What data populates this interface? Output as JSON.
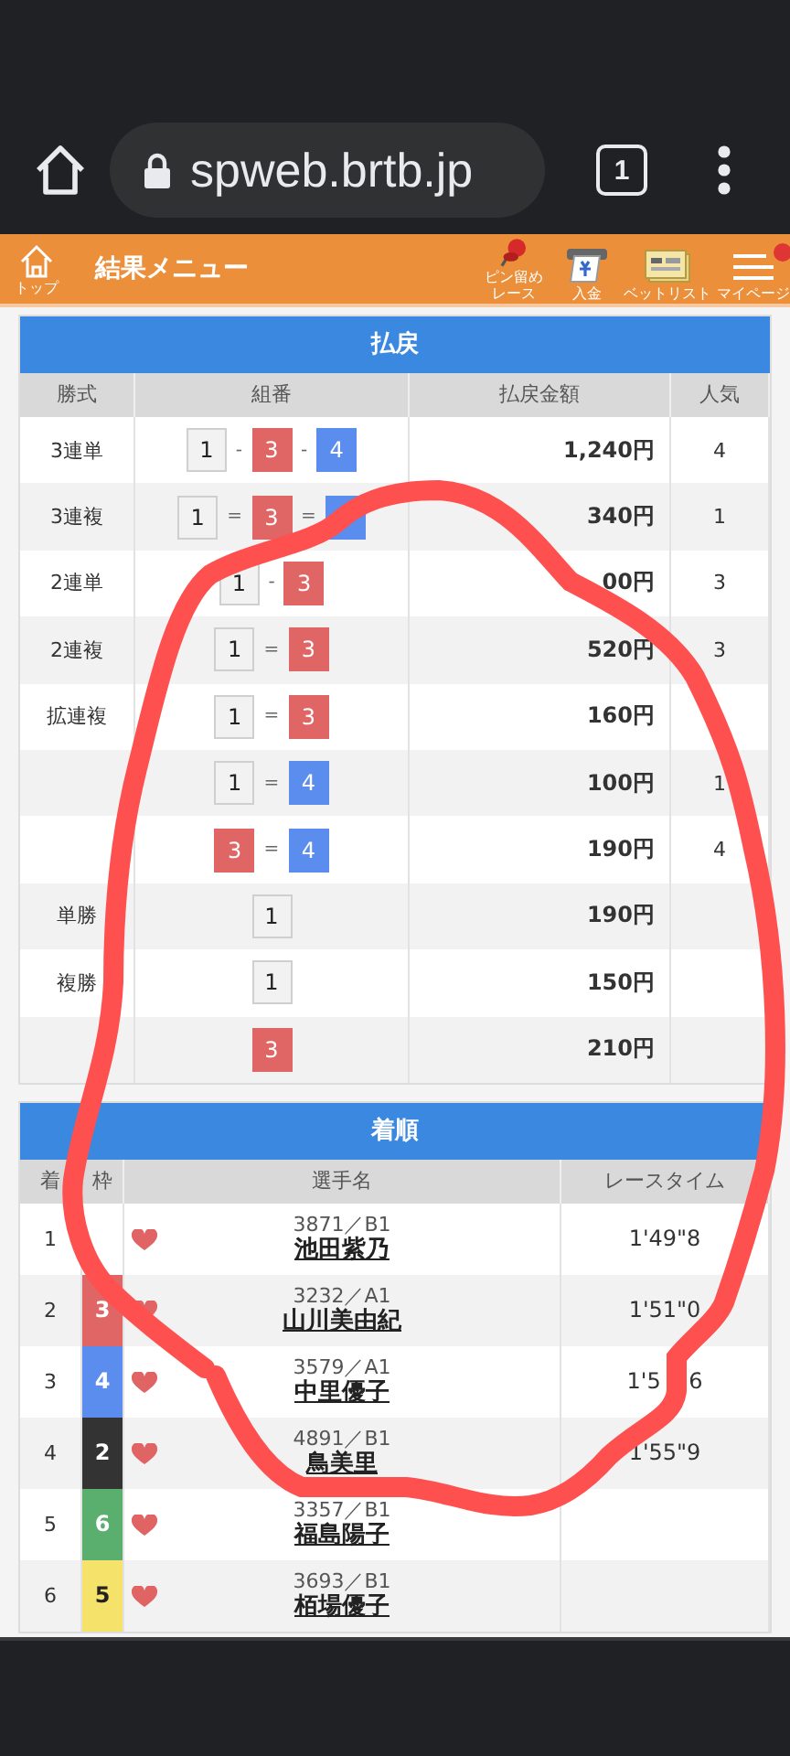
{
  "browser": {
    "url": "spweb.brtb.jp",
    "tab_count": "1"
  },
  "header": {
    "home_label": "トップ",
    "title": "結果メニュー",
    "actions": [
      {
        "kind": "pin",
        "label": "ピン留めレース"
      },
      {
        "kind": "deposit",
        "label": "入金"
      },
      {
        "kind": "betlist",
        "label": "ベットリスト"
      },
      {
        "kind": "mypage",
        "label": "マイページ",
        "badge": true
      }
    ]
  },
  "payout": {
    "title": "払戻",
    "columns": [
      "勝式",
      "組番",
      "払戻金額",
      "人気"
    ],
    "rows": [
      {
        "bet_type": "3連単",
        "combo": {
          "separator": "-",
          "boxes": [
            {
              "number": "1",
              "color": "#f2f2f2"
            },
            {
              "number": "3",
              "color": "#e06666"
            },
            {
              "number": "4",
              "color": "#5b8def"
            }
          ]
        },
        "amount": "1,240円",
        "popularity": "4"
      },
      {
        "bet_type": "3連複",
        "combo": {
          "separator": "=",
          "boxes": [
            {
              "number": "1",
              "color": "#f2f2f2"
            },
            {
              "number": "3",
              "color": "#e06666"
            },
            {
              "color": "#5b8def"
            }
          ]
        },
        "amount": "340円",
        "popularity": "1"
      },
      {
        "bet_type": "2連単",
        "combo": {
          "separator": "-",
          "boxes": [
            {
              "number": "1",
              "color": "#f2f2f2"
            },
            {
              "number": "3",
              "color": "#e06666"
            }
          ]
        },
        "amount": "00円",
        "popularity": "3"
      },
      {
        "bet_type": "2連複",
        "combo": {
          "separator": "=",
          "boxes": [
            {
              "number": "1",
              "color": "#f2f2f2"
            },
            {
              "number": "3",
              "color": "#e06666"
            }
          ]
        },
        "amount": "520円",
        "popularity": "3"
      },
      {
        "bet_type": "拡連複",
        "combo": {
          "separator": "=",
          "boxes": [
            {
              "number": "1",
              "color": "#f2f2f2"
            },
            {
              "number": "3",
              "color": "#e06666"
            }
          ]
        },
        "amount": "160円"
      },
      {
        "combo": {
          "separator": "=",
          "boxes": [
            {
              "number": "1",
              "color": "#f2f2f2"
            },
            {
              "number": "4",
              "color": "#5b8def"
            }
          ]
        },
        "amount": "100円",
        "popularity": "1"
      },
      {
        "combo": {
          "separator": "=",
          "boxes": [
            {
              "number": "3",
              "color": "#e06666"
            },
            {
              "number": "4",
              "color": "#5b8def"
            }
          ]
        },
        "amount": "190円",
        "popularity": "4"
      },
      {
        "bet_type": "単勝",
        "combo": {
          "boxes": [
            {
              "number": "1",
              "color": "#f2f2f2"
            }
          ]
        },
        "amount": "190円"
      },
      {
        "bet_type": "複勝",
        "combo": {
          "boxes": [
            {
              "number": "1",
              "color": "#f2f2f2"
            }
          ]
        },
        "amount": "150円"
      },
      {
        "combo": {
          "boxes": [
            {
              "number": "3",
              "color": "#e06666"
            }
          ]
        },
        "amount": "210円"
      }
    ]
  },
  "results": {
    "title": "着順",
    "columns": [
      "着",
      "枠",
      "選手名",
      "レースタイム"
    ],
    "rows": [
      {
        "rank": "1",
        "frame": {
          "color": "#ffffff"
        },
        "racer_id": "3871／B1",
        "name": "池田紫乃",
        "time": "1'49\"8"
      },
      {
        "rank": "2",
        "frame": {
          "number": "3",
          "color": "#e06666"
        },
        "racer_id": "3232／A1",
        "name": "山川美由紀",
        "time": "1'51\"0"
      },
      {
        "rank": "3",
        "frame": {
          "number": "4",
          "color": "#5b8def"
        },
        "racer_id": "3579／A1",
        "name": "中里優子",
        "time": "1'5    6"
      },
      {
        "rank": "4",
        "frame": {
          "number": "2",
          "color": "#333333"
        },
        "racer_id": "4891／B1",
        "name": "鳥美里",
        "time": "1'55\"9"
      },
      {
        "rank": "5",
        "frame": {
          "number": "6",
          "color": "#5aaf6e"
        },
        "racer_id": "3357／B1",
        "name": "福島陽子"
      },
      {
        "rank": "6",
        "frame": {
          "number": "5",
          "color": "#f5e26a"
        },
        "racer_id": "3693／B1",
        "name": "栢場優子"
      }
    ]
  },
  "annotation": {
    "kind": "circle"
  }
}
